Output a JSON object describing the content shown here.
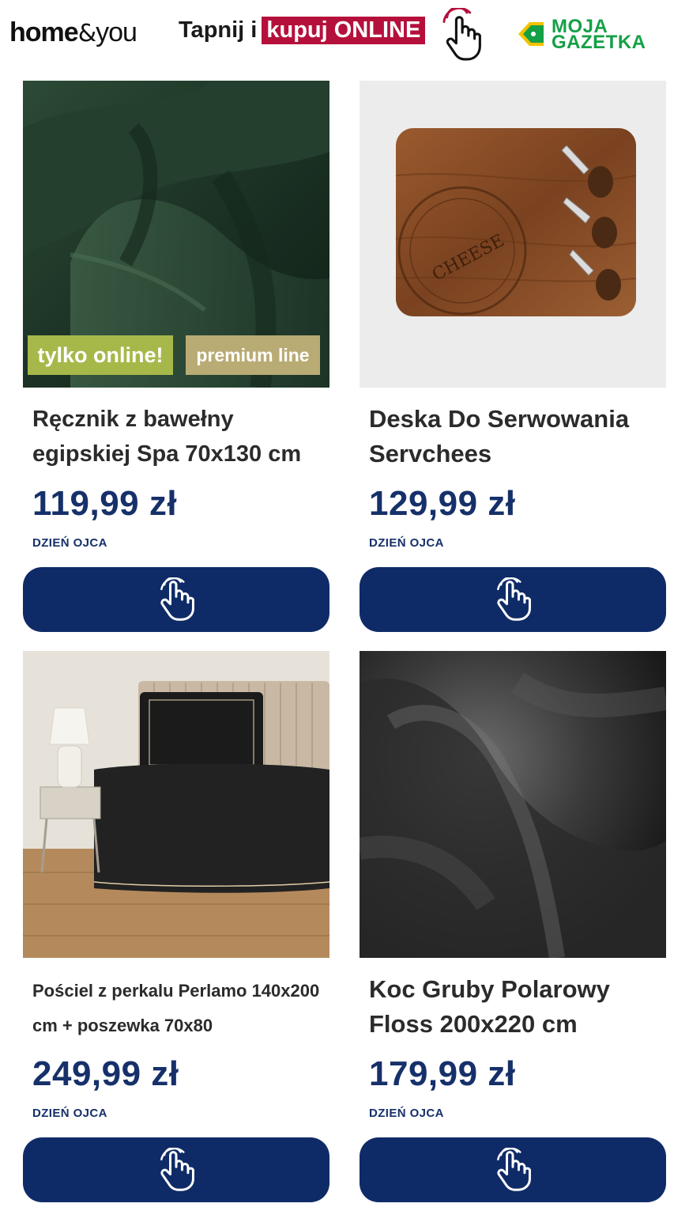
{
  "header": {
    "brand_home": "home",
    "brand_amp": "&",
    "brand_you": "you",
    "promo_text": "Tapnij i",
    "promo_highlight": "kupuj ONLINE",
    "gazetka_line1": "MOJA",
    "gazetka_line2": "GAZETKA"
  },
  "colors": {
    "accent_navy": "#0f2b67",
    "price_navy": "#16306a",
    "promo_red": "#b5103b",
    "badge_online": "#a7b84a",
    "badge_premium": "#b9ab74",
    "gazetka_green": "#14a046"
  },
  "products": [
    {
      "title": "Ręcznik z bawełny egipskiej Spa 70x130 cm",
      "price": "119,99 zł",
      "occasion": "DZIEŃ OJCA",
      "badges": [
        "tylko online!",
        "premium line"
      ],
      "image_icon": "towel-photo",
      "button_icon": "tap-hand-icon"
    },
    {
      "title": "Deska Do Serwowania Servchees",
      "price": "129,99 zł",
      "occasion": "DZIEŃ OJCA",
      "image_icon": "cheese-board-photo",
      "image_text": "CHEESE",
      "button_icon": "tap-hand-icon"
    },
    {
      "title": "Pościel z perkalu Perlamo 140x200 cm + poszewka 70x80",
      "price": "249,99 zł",
      "occasion": "DZIEŃ OJCA",
      "image_icon": "bedding-photo",
      "button_icon": "tap-hand-icon"
    },
    {
      "title": "Koc Gruby Polarowy Floss 200x220 cm",
      "price": "179,99 zł",
      "occasion": "DZIEŃ OJCA",
      "image_icon": "fleece-blanket-photo",
      "button_icon": "tap-hand-icon"
    }
  ]
}
